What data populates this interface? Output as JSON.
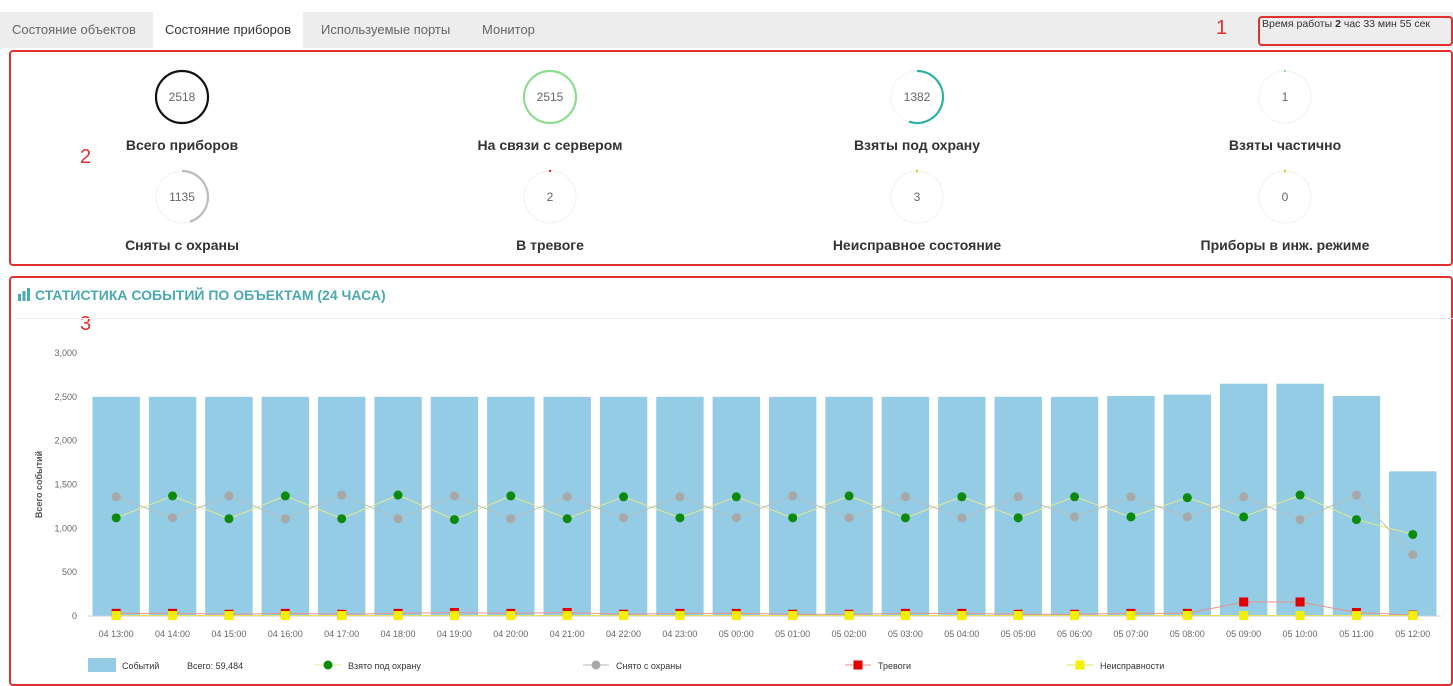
{
  "tabs": [
    {
      "label": "Состояние объектов",
      "active": false
    },
    {
      "label": "Состояние приборов",
      "active": true
    },
    {
      "label": "Используемые порты",
      "active": false
    },
    {
      "label": "Монитор",
      "active": false
    }
  ],
  "uptime": {
    "prefix": "Время работы",
    "hours": "2",
    "rest": "час 33 мин 55 сек"
  },
  "markers": [
    "1",
    "2",
    "3"
  ],
  "stats": [
    {
      "label": "Всего приборов",
      "value": "2518",
      "fraction": 1.0,
      "color": "#111111"
    },
    {
      "label": "На связи с сервером",
      "value": "2515",
      "fraction": 1.0,
      "color": "#8edc8e"
    },
    {
      "label": "Взяты под охрану",
      "value": "1382",
      "fraction": 0.55,
      "color": "#2ab3a0"
    },
    {
      "label": "Взяты частично",
      "value": "1",
      "fraction": 0.003,
      "color": "#8edc8e"
    },
    {
      "label": "Сняты с охраны",
      "value": "1135",
      "fraction": 0.45,
      "color": "#bbbbbb"
    },
    {
      "label": "В тревоге",
      "value": "2",
      "fraction": 0.003,
      "color": "#e03030"
    },
    {
      "label": "Неисправное состояние",
      "value": "3",
      "fraction": 0.003,
      "color": "#e8c400"
    },
    {
      "label": "Приборы в инж. режиме",
      "value": "0",
      "fraction": 0.003,
      "color": "#e8c400"
    }
  ],
  "section": {
    "title": "СТАТИСТИКА СОБЫТИЙ ПО ОБЪЕКТАМ (24 ЧАСА)",
    "icon": "bar-chart-icon"
  },
  "chart_data": {
    "type": "bar",
    "ylabel": "Всего событий",
    "ylim": [
      0,
      3000
    ],
    "yticks": [
      "3,000",
      "2,500",
      "2,000",
      "1,500",
      "1,000",
      "500",
      "0"
    ],
    "categories": [
      "04 13:00",
      "04 14:00",
      "04 15:00",
      "04 16:00",
      "04 17:00",
      "04 18:00",
      "04 19:00",
      "04 20:00",
      "04 21:00",
      "04 22:00",
      "04 23:00",
      "05 00:00",
      "05 01:00",
      "05 02:00",
      "05 03:00",
      "05 04:00",
      "05 05:00",
      "05 06:00",
      "05 07:00",
      "05 08:00",
      "05 09:00",
      "05 10:00",
      "05 11:00",
      "05 12:00"
    ],
    "bars": {
      "name": "Событий",
      "color": "#93cce4",
      "values": [
        2500,
        2500,
        2500,
        2500,
        2500,
        2500,
        2500,
        2500,
        2500,
        2500,
        2500,
        2500,
        2500,
        2500,
        2500,
        2500,
        2500,
        2500,
        2510,
        2525,
        2650,
        2650,
        2510,
        1650
      ]
    },
    "series": [
      {
        "name": "Взято под охрану",
        "color": "#0b8a0b",
        "line": "#e8e88a",
        "marker": "circle",
        "values": [
          1120,
          1370,
          1110,
          1370,
          1110,
          1380,
          1100,
          1370,
          1110,
          1360,
          1120,
          1360,
          1120,
          1370,
          1120,
          1360,
          1120,
          1360,
          1130,
          1350,
          1130,
          1380,
          1100,
          930
        ]
      },
      {
        "name": "Снято с охраны",
        "color": "#a8a8a8",
        "line": "#bbbbbb",
        "marker": "circle",
        "values": [
          1360,
          1120,
          1370,
          1110,
          1380,
          1110,
          1370,
          1110,
          1360,
          1120,
          1360,
          1120,
          1370,
          1120,
          1360,
          1120,
          1360,
          1130,
          1360,
          1130,
          1360,
          1100,
          1380,
          700
        ]
      },
      {
        "name": "Тревоги",
        "color": "#e00000",
        "line": "#e89090",
        "marker": "square",
        "values": [
          30,
          30,
          20,
          30,
          20,
          30,
          40,
          30,
          40,
          20,
          30,
          30,
          20,
          20,
          30,
          30,
          20,
          20,
          30,
          30,
          160,
          160,
          40,
          10
        ]
      },
      {
        "name": "Неисправности",
        "color": "#f5f000",
        "line": "#e0e060",
        "marker": "square",
        "values": [
          5,
          5,
          5,
          5,
          5,
          5,
          5,
          5,
          5,
          5,
          5,
          5,
          5,
          5,
          5,
          5,
          5,
          5,
          5,
          5,
          5,
          5,
          5,
          5
        ]
      }
    ],
    "legend": {
      "position": "bottom",
      "total_label": "Всего: 59,484"
    }
  }
}
